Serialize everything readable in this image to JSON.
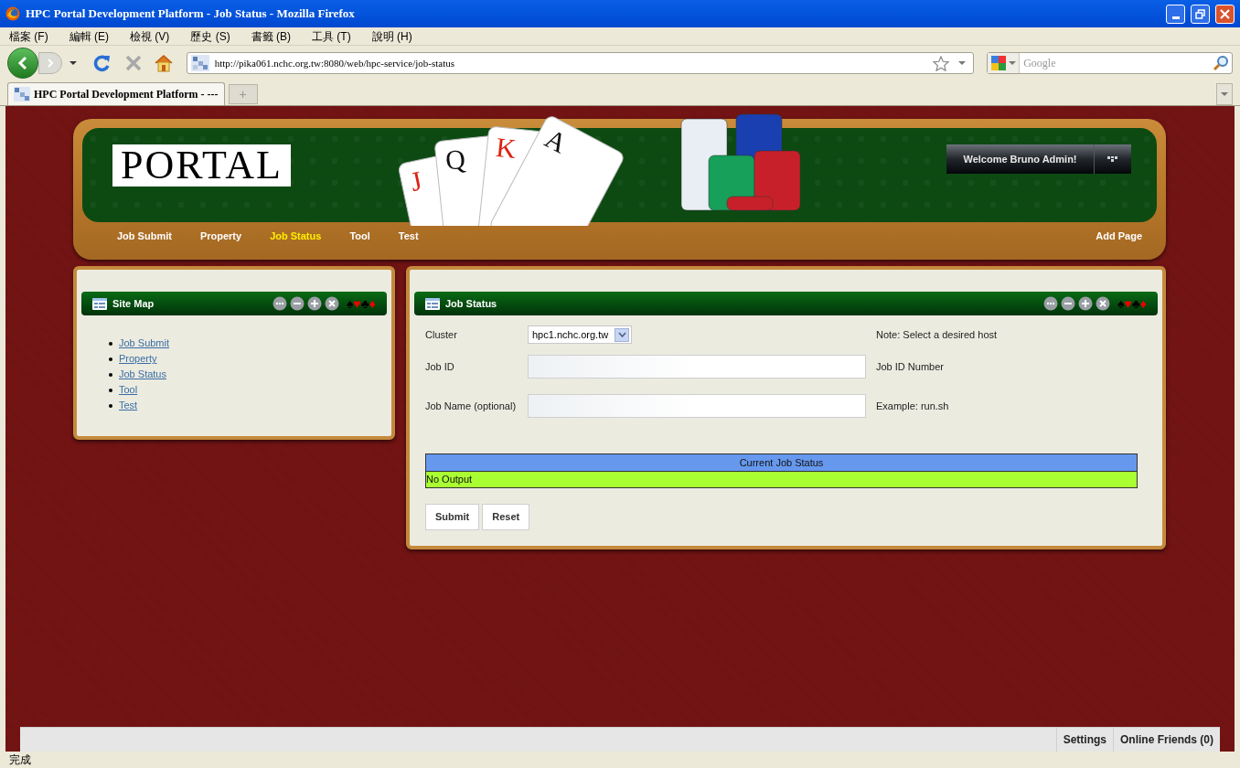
{
  "window": {
    "title": "HPC Portal Development Platform - Job Status - Mozilla Firefox"
  },
  "menu": [
    "檔案 (F)",
    "編輯 (E)",
    "檢視 (V)",
    "歷史 (S)",
    "書籤 (B)",
    "工具 (T)",
    "說明 (H)"
  ],
  "address": {
    "value": "http://pika061.nchc.org.tw:8080/web/hpc-service/job-status"
  },
  "search": {
    "placeholder": "Google"
  },
  "tabs": [
    {
      "label": "HPC Portal Development Platform - ---",
      "selected": true
    }
  ],
  "new_tab": "+",
  "header": {
    "logo": "PORTAL",
    "cards": [
      "J",
      "Q",
      "K",
      "A"
    ],
    "welcome": "Welcome Bruno Admin!",
    "add_page": "Add Page",
    "nav": [
      {
        "label": "Job Submit",
        "selected": false
      },
      {
        "label": "Property",
        "selected": false
      },
      {
        "label": "Job Status",
        "selected": true
      },
      {
        "label": "Tool",
        "selected": false
      },
      {
        "label": "Test",
        "selected": false
      }
    ]
  },
  "suits": [
    {
      "glyph": "♠",
      "color": "#000000"
    },
    {
      "glyph": "♥",
      "color": "#ee0000"
    },
    {
      "glyph": "♣",
      "color": "#000000"
    },
    {
      "glyph": "♦",
      "color": "#ee0000"
    }
  ],
  "site_map": {
    "title": "Site Map",
    "links": [
      "Job Submit",
      "Property",
      "Job Status",
      "Tool",
      "Test"
    ]
  },
  "job_status": {
    "title": "Job Status",
    "fields": [
      {
        "kind": "select",
        "label": "Cluster",
        "value": "hpc1.nchc.org.tw",
        "note": "Note: Select a desired host"
      },
      {
        "kind": "text",
        "label": "Job ID",
        "note": "Job ID Number"
      },
      {
        "kind": "text",
        "label": "Job Name (optional)",
        "note": "Example: run.sh"
      }
    ],
    "table": {
      "header": "Current Job Status",
      "rows": [
        "No Output"
      ]
    },
    "buttons": [
      "Submit",
      "Reset"
    ]
  },
  "dock": [
    "Settings",
    "Online Friends (0)"
  ],
  "status_bar": "完成"
}
